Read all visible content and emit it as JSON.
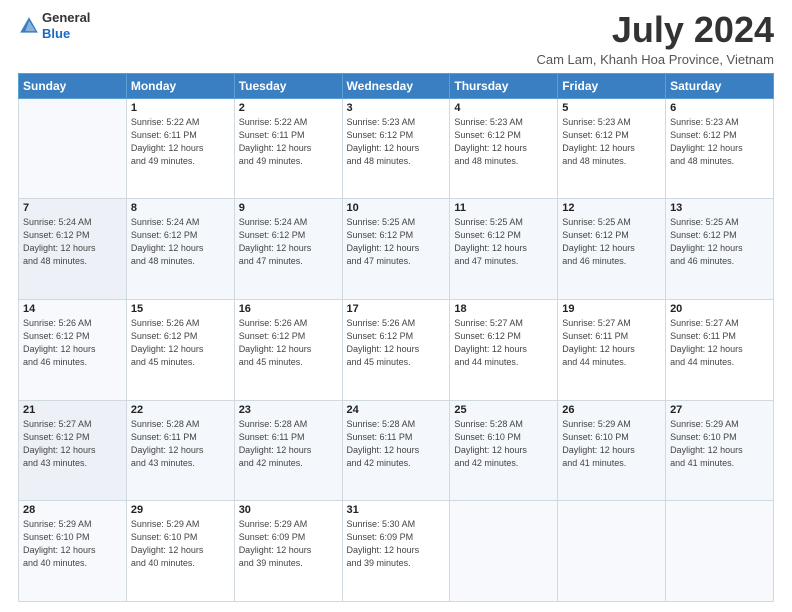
{
  "header": {
    "logo_line1": "General",
    "logo_line2": "Blue",
    "month_year": "July 2024",
    "location": "Cam Lam, Khanh Hoa Province, Vietnam"
  },
  "weekdays": [
    "Sunday",
    "Monday",
    "Tuesday",
    "Wednesday",
    "Thursday",
    "Friday",
    "Saturday"
  ],
  "weeks": [
    [
      {
        "day": "",
        "info": ""
      },
      {
        "day": "1",
        "info": "Sunrise: 5:22 AM\nSunset: 6:11 PM\nDaylight: 12 hours\nand 49 minutes."
      },
      {
        "day": "2",
        "info": "Sunrise: 5:22 AM\nSunset: 6:11 PM\nDaylight: 12 hours\nand 49 minutes."
      },
      {
        "day": "3",
        "info": "Sunrise: 5:23 AM\nSunset: 6:12 PM\nDaylight: 12 hours\nand 48 minutes."
      },
      {
        "day": "4",
        "info": "Sunrise: 5:23 AM\nSunset: 6:12 PM\nDaylight: 12 hours\nand 48 minutes."
      },
      {
        "day": "5",
        "info": "Sunrise: 5:23 AM\nSunset: 6:12 PM\nDaylight: 12 hours\nand 48 minutes."
      },
      {
        "day": "6",
        "info": "Sunrise: 5:23 AM\nSunset: 6:12 PM\nDaylight: 12 hours\nand 48 minutes."
      }
    ],
    [
      {
        "day": "7",
        "info": ""
      },
      {
        "day": "8",
        "info": "Sunrise: 5:24 AM\nSunset: 6:12 PM\nDaylight: 12 hours\nand 48 minutes."
      },
      {
        "day": "9",
        "info": "Sunrise: 5:24 AM\nSunset: 6:12 PM\nDaylight: 12 hours\nand 47 minutes."
      },
      {
        "day": "10",
        "info": "Sunrise: 5:25 AM\nSunset: 6:12 PM\nDaylight: 12 hours\nand 47 minutes."
      },
      {
        "day": "11",
        "info": "Sunrise: 5:25 AM\nSunset: 6:12 PM\nDaylight: 12 hours\nand 47 minutes."
      },
      {
        "day": "12",
        "info": "Sunrise: 5:25 AM\nSunset: 6:12 PM\nDaylight: 12 hours\nand 46 minutes."
      },
      {
        "day": "13",
        "info": "Sunrise: 5:25 AM\nSunset: 6:12 PM\nDaylight: 12 hours\nand 46 minutes."
      }
    ],
    [
      {
        "day": "14",
        "info": ""
      },
      {
        "day": "15",
        "info": "Sunrise: 5:26 AM\nSunset: 6:12 PM\nDaylight: 12 hours\nand 45 minutes."
      },
      {
        "day": "16",
        "info": "Sunrise: 5:26 AM\nSunset: 6:12 PM\nDaylight: 12 hours\nand 45 minutes."
      },
      {
        "day": "17",
        "info": "Sunrise: 5:26 AM\nSunset: 6:12 PM\nDaylight: 12 hours\nand 45 minutes."
      },
      {
        "day": "18",
        "info": "Sunrise: 5:27 AM\nSunset: 6:12 PM\nDaylight: 12 hours\nand 44 minutes."
      },
      {
        "day": "19",
        "info": "Sunrise: 5:27 AM\nSunset: 6:11 PM\nDaylight: 12 hours\nand 44 minutes."
      },
      {
        "day": "20",
        "info": "Sunrise: 5:27 AM\nSunset: 6:11 PM\nDaylight: 12 hours\nand 44 minutes."
      }
    ],
    [
      {
        "day": "21",
        "info": ""
      },
      {
        "day": "22",
        "info": "Sunrise: 5:28 AM\nSunset: 6:11 PM\nDaylight: 12 hours\nand 43 minutes."
      },
      {
        "day": "23",
        "info": "Sunrise: 5:28 AM\nSunset: 6:11 PM\nDaylight: 12 hours\nand 42 minutes."
      },
      {
        "day": "24",
        "info": "Sunrise: 5:28 AM\nSunset: 6:11 PM\nDaylight: 12 hours\nand 42 minutes."
      },
      {
        "day": "25",
        "info": "Sunrise: 5:28 AM\nSunset: 6:10 PM\nDaylight: 12 hours\nand 42 minutes."
      },
      {
        "day": "26",
        "info": "Sunrise: 5:29 AM\nSunset: 6:10 PM\nDaylight: 12 hours\nand 41 minutes."
      },
      {
        "day": "27",
        "info": "Sunrise: 5:29 AM\nSunset: 6:10 PM\nDaylight: 12 hours\nand 41 minutes."
      }
    ],
    [
      {
        "day": "28",
        "info": "Sunrise: 5:29 AM\nSunset: 6:10 PM\nDaylight: 12 hours\nand 40 minutes."
      },
      {
        "day": "29",
        "info": "Sunrise: 5:29 AM\nSunset: 6:10 PM\nDaylight: 12 hours\nand 40 minutes."
      },
      {
        "day": "30",
        "info": "Sunrise: 5:29 AM\nSunset: 6:09 PM\nDaylight: 12 hours\nand 39 minutes."
      },
      {
        "day": "31",
        "info": "Sunrise: 5:30 AM\nSunset: 6:09 PM\nDaylight: 12 hours\nand 39 minutes."
      },
      {
        "day": "",
        "info": ""
      },
      {
        "day": "",
        "info": ""
      },
      {
        "day": "",
        "info": ""
      }
    ]
  ],
  "week1_sunday_info": "Sunrise: 5:26 AM\nSunset: 6:12 PM\nDaylight: 12 hours\nand 46 minutes.",
  "week3_sunday_info": "Sunrise: 5:26 AM\nSunset: 6:12 PM\nDaylight: 12 hours\nand 46 minutes.",
  "week4_sunday_info": "Sunrise: 5:27 AM\nSunset: 6:12 PM\nDaylight: 12 hours\nand 43 minutes."
}
